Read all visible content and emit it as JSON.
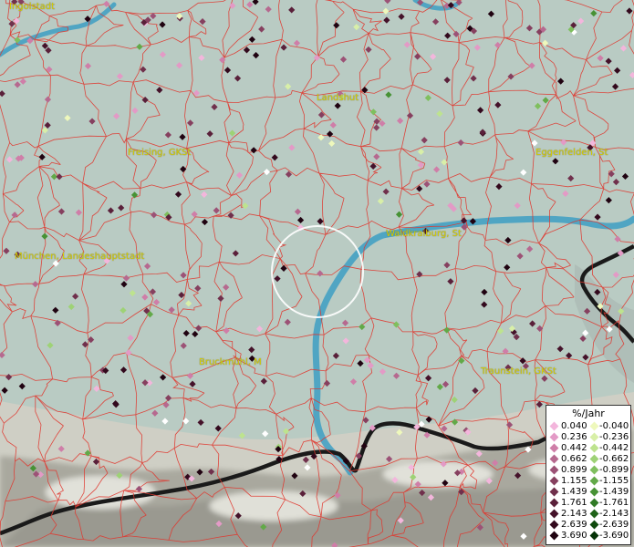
{
  "map": {
    "places": [
      {
        "name": "Ingolstadt",
        "id": "ingolstadt"
      },
      {
        "name": "Landshut",
        "id": "landshut"
      },
      {
        "name": "Freising, GKSt",
        "id": "freising"
      },
      {
        "name": "Eggenfelden, St",
        "id": "eggenfelden"
      },
      {
        "name": "Waldkraiburg, St",
        "id": "waldkraiburg"
      },
      {
        "name": "München, Landeshauptstadt",
        "id": "muenchen"
      },
      {
        "name": "Bruckmühl, M",
        "id": "bruckmuehl"
      },
      {
        "name": "Traunstein, GKSt",
        "id": "traunstein"
      }
    ],
    "colors": {
      "terrain": "#b9cbc3",
      "borders": "#e0362e",
      "river": "#3d9fc3",
      "national_border": "#1a1a1a",
      "label": "#d6d000",
      "highlight_circle": "#ffffff"
    }
  },
  "legend": {
    "unit": "%/Jahr",
    "positive": [
      {
        "value": "0.040",
        "color": "#f3b6dc"
      },
      {
        "value": "0.236",
        "color": "#e39ac6"
      },
      {
        "value": "0.442",
        "color": "#cf7ea8"
      },
      {
        "value": "0.662",
        "color": "#b6698f"
      },
      {
        "value": "0.899",
        "color": "#9c5276"
      },
      {
        "value": "1.155",
        "color": "#86405f"
      },
      {
        "value": "1.439",
        "color": "#70304c"
      },
      {
        "value": "1.761",
        "color": "#5a203a"
      },
      {
        "value": "2.143",
        "color": "#45122a"
      },
      {
        "value": "2.639",
        "color": "#33091d"
      },
      {
        "value": "3.690",
        "color": "#200311"
      }
    ],
    "negative": [
      {
        "value": "-0.040",
        "color": "#eef8bc"
      },
      {
        "value": "-0.236",
        "color": "#d8efa8"
      },
      {
        "value": "-0.442",
        "color": "#bde38e"
      },
      {
        "value": "-0.662",
        "color": "#9ed276"
      },
      {
        "value": "-0.899",
        "color": "#7fbf5e"
      },
      {
        "value": "-1.155",
        "color": "#62a948"
      },
      {
        "value": "-1.439",
        "color": "#479235"
      },
      {
        "value": "-1.761",
        "color": "#307a25"
      },
      {
        "value": "-2.143",
        "color": "#1e6218"
      },
      {
        "value": "-2.639",
        "color": "#0f4a0d"
      },
      {
        "value": "-3.690",
        "color": "#053306"
      }
    ]
  }
}
